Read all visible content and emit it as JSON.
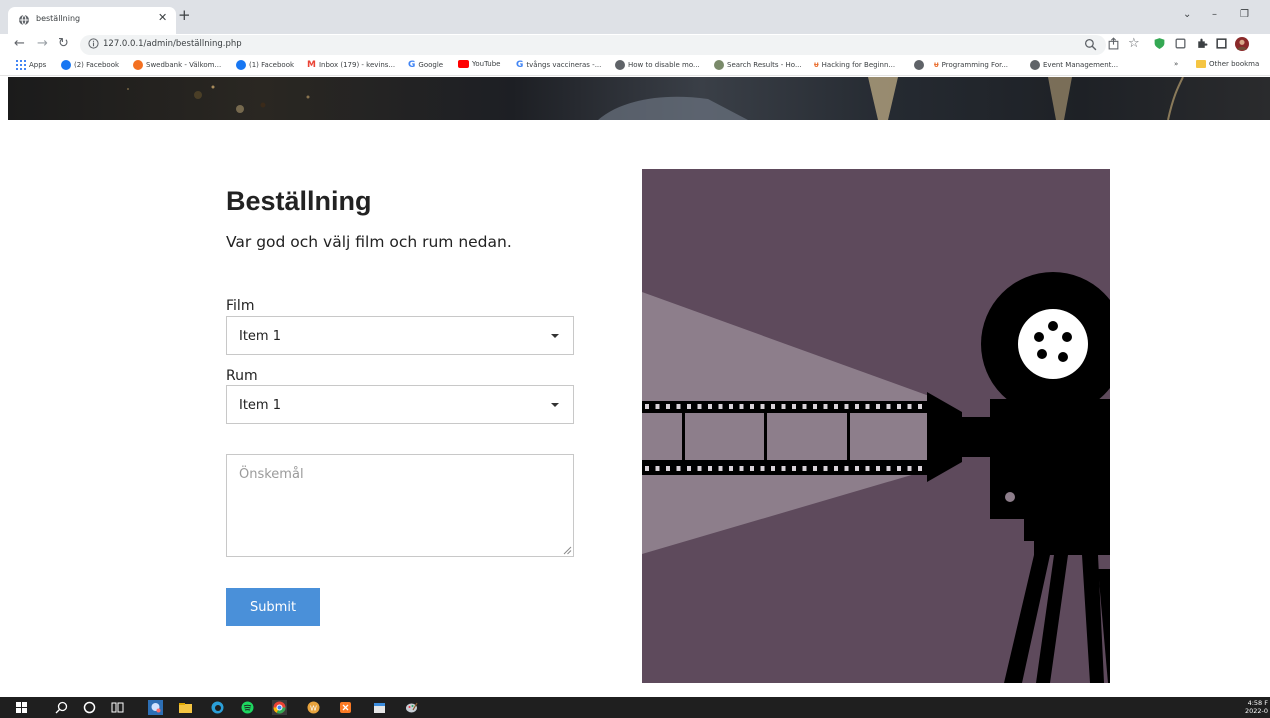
{
  "browser": {
    "tab": {
      "title": "beställning",
      "favicon": "globe-icon"
    },
    "url": "127.0.0.1/admin/beställning.php",
    "bookmarks": [
      {
        "label": "Apps",
        "icon": "apps-grid-icon",
        "color": "#4285f4"
      },
      {
        "label": "(2) Facebook",
        "icon": "facebook-icon",
        "color": "#1877f2"
      },
      {
        "label": "Swedbank - Välkom...",
        "icon": "swedbank-icon",
        "color": "#f37021"
      },
      {
        "label": "(1) Facebook",
        "icon": "facebook-icon",
        "color": "#1877f2"
      },
      {
        "label": "Inbox (179) - kevins...",
        "icon": "gmail-icon",
        "color": "#ea4335"
      },
      {
        "label": "Google",
        "icon": "google-icon",
        "color": "#4285f4"
      },
      {
        "label": "YouTube",
        "icon": "youtube-icon",
        "color": "#ff0000"
      },
      {
        "label": "tvångs vaccineras -...",
        "icon": "google-icon",
        "color": "#4285f4"
      },
      {
        "label": "How to disable mo...",
        "icon": "globe-icon",
        "color": "#5f6368"
      },
      {
        "label": "Search Results - Ho...",
        "icon": "site-icon",
        "color": "#7a8a6a"
      },
      {
        "label": "Hacking for Beginn...",
        "icon": "udemy-icon",
        "color": "#e96b2a"
      },
      {
        "label": "",
        "icon": "globe-icon",
        "color": "#5f6368"
      },
      {
        "label": "Programming For...",
        "icon": "udemy-icon",
        "color": "#e96b2a"
      },
      {
        "label": "Event Management...",
        "icon": "globe-icon",
        "color": "#5f6368"
      }
    ],
    "bookmarks_overflow": "»",
    "other_bookmarks": "Other bookma"
  },
  "form": {
    "title": "Beställning",
    "subtitle": "Var god och välj film och rum nedan.",
    "film_label": "Film",
    "film_value": "Item 1",
    "rum_label": "Rum",
    "rum_value": "Item 1",
    "wish_placeholder": "Önskemål",
    "submit_label": "Submit"
  },
  "illustration": {
    "subject": "film-projector-icon",
    "background_color": "#5e4a5c",
    "beam_color": "#8d7e8b",
    "ink_color": "#000000"
  },
  "taskbar": {
    "time": "4:58 F",
    "date": "2022-0"
  },
  "colors": {
    "submit": "#4a90d9"
  }
}
